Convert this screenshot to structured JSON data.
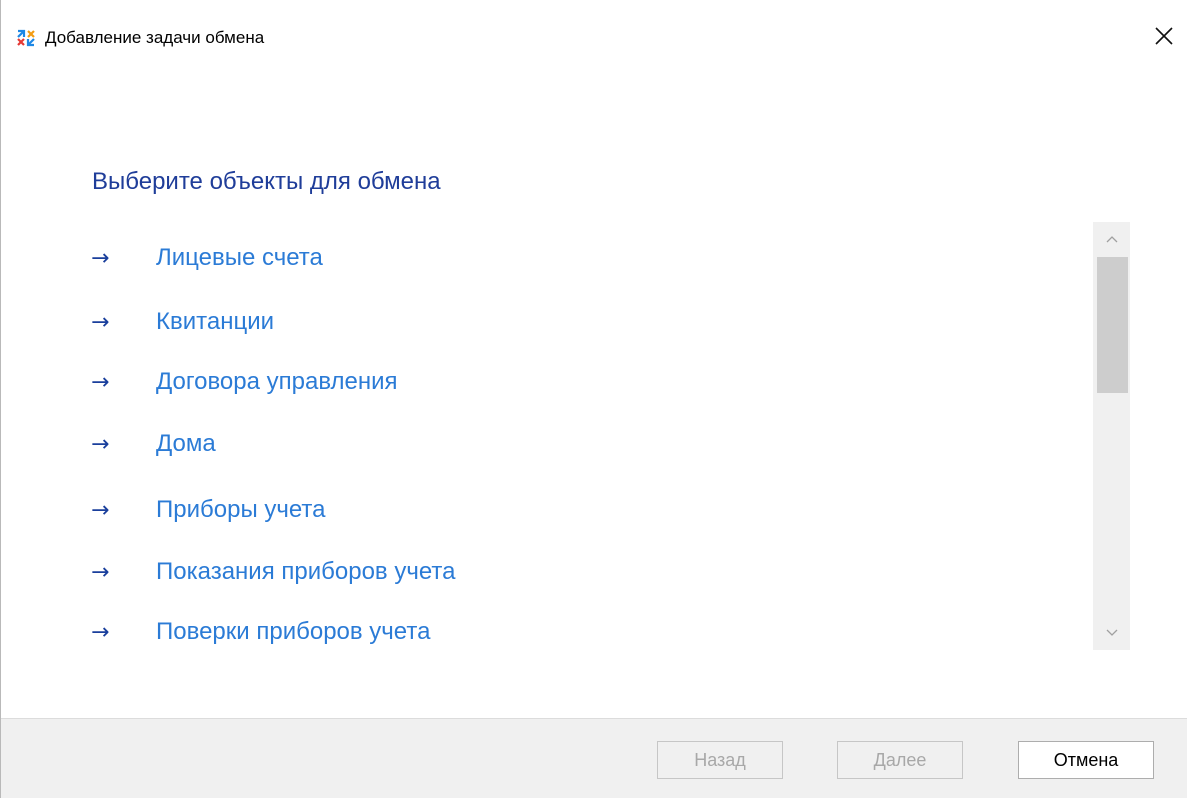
{
  "window": {
    "title": "Добавление задачи обмена",
    "icon": "exchange-app-icon",
    "close_icon": "close-icon"
  },
  "main": {
    "heading": "Выберите объекты для обмена",
    "arrow_glyph": "→",
    "items": [
      {
        "label": "Лицевые счета"
      },
      {
        "label": "Квитанции"
      },
      {
        "label": "Договора управления"
      },
      {
        "label": "Дома"
      },
      {
        "label": "Приборы учета"
      },
      {
        "label": "Показания приборов учета"
      },
      {
        "label": "Поверки приборов учета"
      }
    ]
  },
  "footer": {
    "back_label": "Назад",
    "next_label": "Далее",
    "cancel_label": "Отмена"
  },
  "colors": {
    "heading": "#1f3d99",
    "link": "#2b7bd6",
    "arrow": "#1a3f9c",
    "footer_bg": "#f0f0f0"
  }
}
